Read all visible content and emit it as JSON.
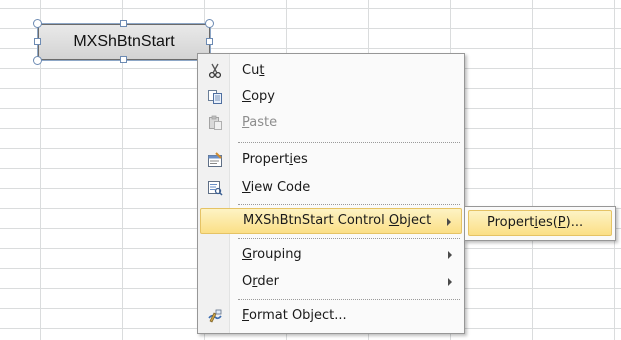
{
  "control": {
    "label": "MXShBtnStart"
  },
  "menu": {
    "items": [
      {
        "pre": "Cu",
        "key": "t",
        "post": "",
        "icon": "scissors-icon",
        "enabled": true
      },
      {
        "pre": "",
        "key": "C",
        "post": "opy",
        "icon": "copy-icon",
        "enabled": true
      },
      {
        "pre": "",
        "key": "P",
        "post": "aste",
        "icon": "paste-icon",
        "enabled": false
      },
      {
        "pre": "Propert",
        "key": "i",
        "post": "es",
        "icon": "properties-icon",
        "enabled": true
      },
      {
        "pre": "",
        "key": "V",
        "post": "iew Code",
        "icon": "view-code-icon",
        "enabled": true
      },
      {
        "pre": "MXShBtnStart Control ",
        "key": "O",
        "post": "bject",
        "icon": "",
        "enabled": true
      },
      {
        "pre": "",
        "key": "G",
        "post": "rouping",
        "icon": "",
        "enabled": true
      },
      {
        "pre": "O",
        "key": "r",
        "post": "der",
        "icon": "",
        "enabled": true
      },
      {
        "pre": "",
        "key": "F",
        "post": "ormat Object...",
        "icon": "format-object-icon",
        "enabled": true
      }
    ]
  },
  "submenu": {
    "item": {
      "pre": "Propert",
      "key": "i",
      "mid": "es(",
      "key2": "P",
      "post": ")..."
    }
  }
}
